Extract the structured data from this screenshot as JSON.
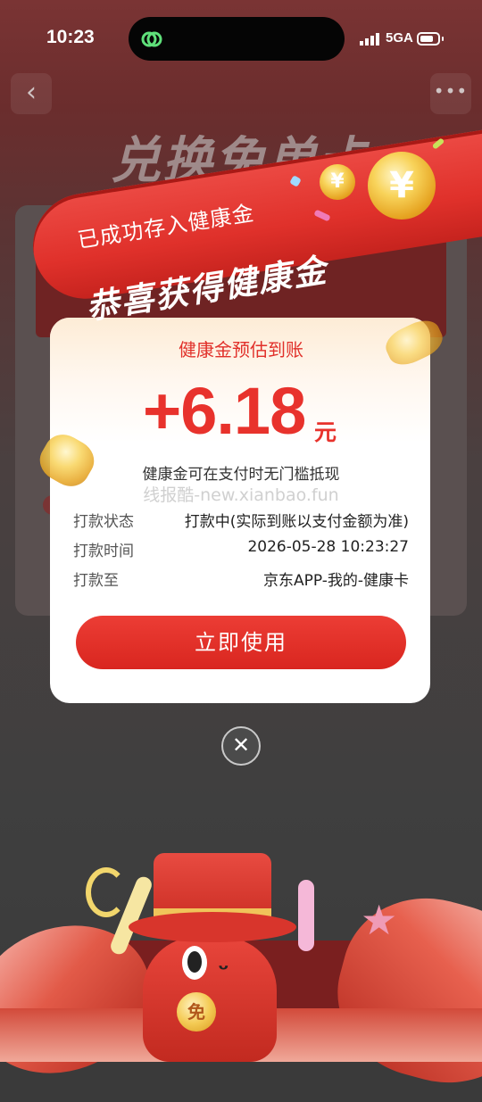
{
  "status_bar": {
    "time": "10:23",
    "network": "5GA",
    "icons": [
      "link-icon",
      "signal-icon",
      "battery-icon"
    ]
  },
  "background_page": {
    "title": "兑换免单卡",
    "nav_icons": [
      "back-arrow-icon",
      "more-dots-icon"
    ]
  },
  "banner": {
    "top_text": "已成功存入健康金",
    "main_text": "恭喜获得健康金",
    "coin_symbol": "¥"
  },
  "modal": {
    "subtitle": "健康金预估到账",
    "amount": "+6.18",
    "amount_unit": "元",
    "description": "健康金可在支付时无门槛抵现",
    "watermark": "线报酷-new.xianbao.fun",
    "rows": [
      {
        "label": "打款状态",
        "value": "打款中(实际到账以支付金额为准)"
      },
      {
        "label": "打款时间",
        "value": "2026-05-28 10:23:27"
      },
      {
        "label": "打款至",
        "value": "京东APP-我的-健康卡"
      }
    ],
    "use_button": "立即使用",
    "close_icon": "✕"
  },
  "mascot": {
    "medal_text": "免"
  },
  "colors": {
    "accent_red": "#e8322c",
    "button_red": "#d9261f",
    "overlay": "#3b3b3b",
    "coin_gold": "#f4cb55"
  }
}
